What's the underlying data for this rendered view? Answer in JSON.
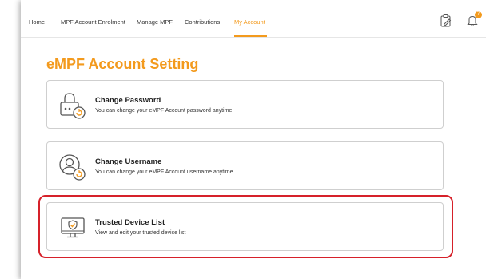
{
  "nav": {
    "items": [
      {
        "label": "Home",
        "active": false
      },
      {
        "label": "MPF Account Enrolment",
        "active": false
      },
      {
        "label": "Manage MPF",
        "active": false
      },
      {
        "label": "Contributions",
        "active": false
      },
      {
        "label": "My Account",
        "active": true
      }
    ],
    "icons": [
      "clipboard-edit-icon",
      "bell-icon"
    ],
    "notification_count": "7"
  },
  "page_title": "eMPF Account Setting",
  "cards": [
    {
      "title": "Change Password",
      "description": "You can change your eMPF Account password anytime",
      "icon": "lock-reset-icon"
    },
    {
      "title": "Change Username",
      "description": "You can change your eMPF Account username anytime",
      "icon": "user-reset-icon"
    },
    {
      "title": "Trusted Device List",
      "description": "View and edit your trusted device list",
      "icon": "trusted-monitor-icon",
      "highlighted": true
    }
  ],
  "colors": {
    "accent": "#f39a1d",
    "highlight": "#d6212a",
    "icon_stroke": "#555555"
  }
}
